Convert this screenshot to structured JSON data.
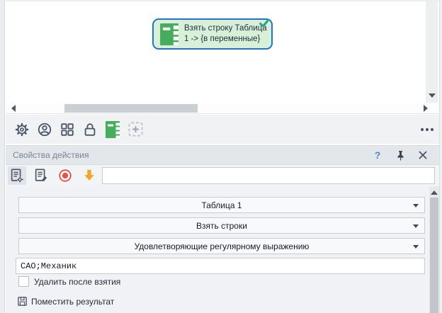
{
  "colors": {
    "node_fill": "#d9f0d8",
    "node_border": "#1b78c6",
    "table_icon_green": "#45ad5b",
    "record_red": "#e25349",
    "arrow_orange": "#f2a52b",
    "help_blue": "#4a86c8",
    "icon_slate": "#4a5568"
  },
  "canvas": {
    "node": {
      "line1": "Взять строку Таблица",
      "line2": "1 -> {в переменные}"
    }
  },
  "icons": {
    "canvas_toolbar": [
      "gear",
      "user",
      "apps-grid",
      "lock",
      "table",
      "add-region-dashed-plus"
    ],
    "panel_toolbar": [
      "action-properties-doc-gear",
      "action-edit-doc-pencil",
      "record",
      "down-arrow"
    ],
    "panel_header": [
      "help",
      "pin",
      "close"
    ],
    "more": "ellipsis"
  },
  "panel": {
    "title": "Свойства действия",
    "help_label": "?",
    "toolbar": {
      "search_value": ""
    },
    "fields": {
      "table": "Таблица 1",
      "action": "Взять строки",
      "condition": "Удовлетворяющие регулярному выражению",
      "regex": "САО;Механик"
    },
    "delete_after": {
      "label": "Удалить после взятия",
      "checked": false
    },
    "place_result": {
      "label": "Поместить результат"
    }
  }
}
